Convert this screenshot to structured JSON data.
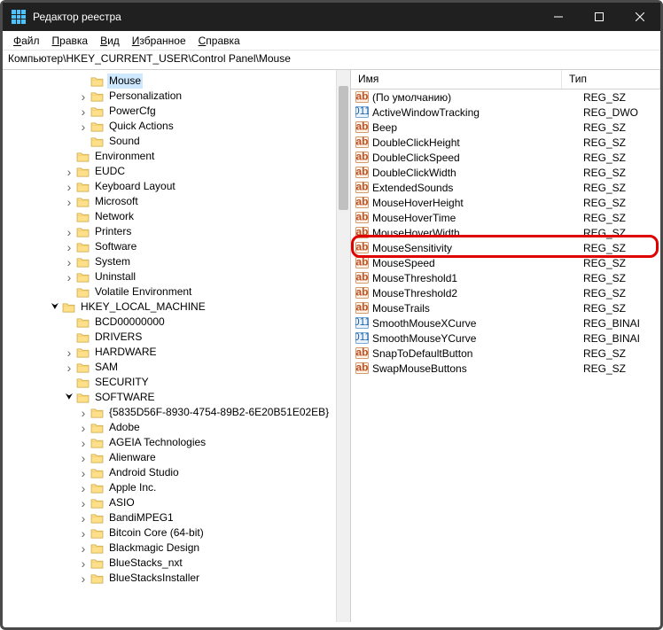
{
  "window": {
    "title": "Редактор реестра"
  },
  "menu": [
    "Файл",
    "Правка",
    "Вид",
    "Избранное",
    "Справка"
  ],
  "address": "Компьютер\\HKEY_CURRENT_USER\\Control Panel\\Mouse",
  "tree": [
    {
      "d": 5,
      "c": "",
      "l": "Mouse",
      "sel": true
    },
    {
      "d": 5,
      "c": ">",
      "l": "Personalization"
    },
    {
      "d": 5,
      "c": ">",
      "l": "PowerCfg"
    },
    {
      "d": 5,
      "c": ">",
      "l": "Quick Actions"
    },
    {
      "d": 5,
      "c": "",
      "l": "Sound"
    },
    {
      "d": 4,
      "c": "",
      "l": "Environment"
    },
    {
      "d": 4,
      "c": ">",
      "l": "EUDC"
    },
    {
      "d": 4,
      "c": ">",
      "l": "Keyboard Layout"
    },
    {
      "d": 4,
      "c": ">",
      "l": "Microsoft"
    },
    {
      "d": 4,
      "c": "",
      "l": "Network"
    },
    {
      "d": 4,
      "c": ">",
      "l": "Printers"
    },
    {
      "d": 4,
      "c": ">",
      "l": "Software"
    },
    {
      "d": 4,
      "c": ">",
      "l": "System"
    },
    {
      "d": 4,
      "c": ">",
      "l": "Uninstall"
    },
    {
      "d": 4,
      "c": "",
      "l": "Volatile Environment"
    },
    {
      "d": 3,
      "c": "v",
      "l": "HKEY_LOCAL_MACHINE"
    },
    {
      "d": 4,
      "c": "",
      "l": "BCD00000000"
    },
    {
      "d": 4,
      "c": "",
      "l": "DRIVERS"
    },
    {
      "d": 4,
      "c": ">",
      "l": "HARDWARE"
    },
    {
      "d": 4,
      "c": ">",
      "l": "SAM"
    },
    {
      "d": 4,
      "c": "",
      "l": "SECURITY"
    },
    {
      "d": 4,
      "c": "v",
      "l": "SOFTWARE"
    },
    {
      "d": 5,
      "c": ">",
      "l": "{5835D56F-8930-4754-89B2-6E20B51E02EB}"
    },
    {
      "d": 5,
      "c": ">",
      "l": "Adobe"
    },
    {
      "d": 5,
      "c": ">",
      "l": "AGEIA Technologies"
    },
    {
      "d": 5,
      "c": ">",
      "l": "Alienware"
    },
    {
      "d": 5,
      "c": ">",
      "l": "Android Studio"
    },
    {
      "d": 5,
      "c": ">",
      "l": "Apple Inc."
    },
    {
      "d": 5,
      "c": ">",
      "l": "ASIO"
    },
    {
      "d": 5,
      "c": ">",
      "l": "BandiMPEG1"
    },
    {
      "d": 5,
      "c": ">",
      "l": "Bitcoin Core (64-bit)"
    },
    {
      "d": 5,
      "c": ">",
      "l": "Blackmagic Design"
    },
    {
      "d": 5,
      "c": ">",
      "l": "BlueStacks_nxt"
    },
    {
      "d": 5,
      "c": ">",
      "l": "BlueStacksInstaller"
    }
  ],
  "columns": {
    "name": "Имя",
    "type": "Тип"
  },
  "values": [
    {
      "n": "(По умолчанию)",
      "t": "REG_SZ",
      "k": "sz"
    },
    {
      "n": "ActiveWindowTracking",
      "t": "REG_DWO",
      "k": "bin"
    },
    {
      "n": "Beep",
      "t": "REG_SZ",
      "k": "sz"
    },
    {
      "n": "DoubleClickHeight",
      "t": "REG_SZ",
      "k": "sz"
    },
    {
      "n": "DoubleClickSpeed",
      "t": "REG_SZ",
      "k": "sz"
    },
    {
      "n": "DoubleClickWidth",
      "t": "REG_SZ",
      "k": "sz"
    },
    {
      "n": "ExtendedSounds",
      "t": "REG_SZ",
      "k": "sz"
    },
    {
      "n": "MouseHoverHeight",
      "t": "REG_SZ",
      "k": "sz"
    },
    {
      "n": "MouseHoverTime",
      "t": "REG_SZ",
      "k": "sz"
    },
    {
      "n": "MouseHoverWidth",
      "t": "REG_SZ",
      "k": "sz"
    },
    {
      "n": "MouseSensitivity",
      "t": "REG_SZ",
      "k": "sz",
      "hl": true
    },
    {
      "n": "MouseSpeed",
      "t": "REG_SZ",
      "k": "sz"
    },
    {
      "n": "MouseThreshold1",
      "t": "REG_SZ",
      "k": "sz"
    },
    {
      "n": "MouseThreshold2",
      "t": "REG_SZ",
      "k": "sz"
    },
    {
      "n": "MouseTrails",
      "t": "REG_SZ",
      "k": "sz"
    },
    {
      "n": "SmoothMouseXCurve",
      "t": "REG_BINAI",
      "k": "bin"
    },
    {
      "n": "SmoothMouseYCurve",
      "t": "REG_BINAI",
      "k": "bin"
    },
    {
      "n": "SnapToDefaultButton",
      "t": "REG_SZ",
      "k": "sz"
    },
    {
      "n": "SwapMouseButtons",
      "t": "REG_SZ",
      "k": "sz"
    }
  ]
}
